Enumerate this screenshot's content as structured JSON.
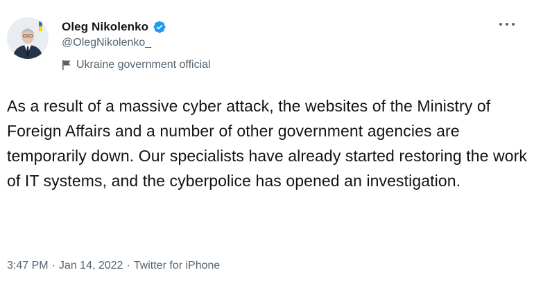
{
  "author": {
    "display_name": "Oleg Nikolenko",
    "handle": "@OlegNikolenko_",
    "label": "Ukraine government official",
    "verified": true
  },
  "tweet": {
    "text": "As a result of a massive cyber attack, the websites of the Ministry of Foreign Affairs and a number of other government agencies are temporarily down. Our specialists have already started restoring the work of IT systems, and the cyberpolice has opened an investigation.",
    "time": "3:47 PM",
    "separator": "·",
    "date": "Jan 14, 2022",
    "source": "Twitter for iPhone"
  },
  "colors": {
    "verified": "#1d9bf0",
    "secondary_text": "#536471",
    "primary_text": "#0f1419"
  },
  "icons": {
    "verified": "verified-badge-icon",
    "label": "government-flag-icon",
    "more": "more-options-icon"
  }
}
